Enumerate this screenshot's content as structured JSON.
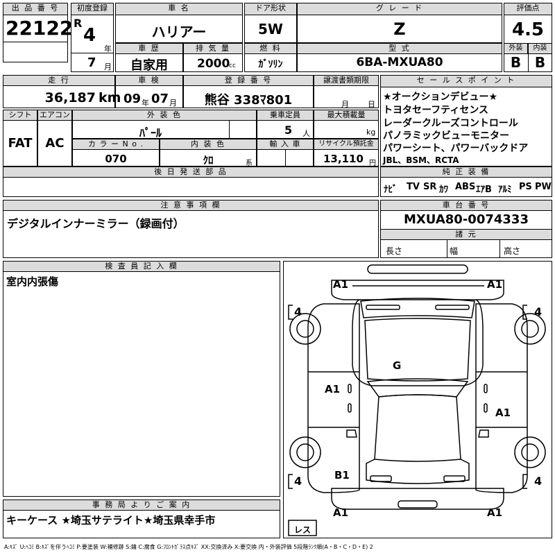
{
  "lot": {
    "label": "出 品 番 号",
    "value": "22122"
  },
  "first_reg": {
    "label": "初度登録",
    "era": "R",
    "year": "4",
    "year_unit": "年",
    "month": "7",
    "month_unit": "月"
  },
  "car_name": {
    "label": "車 名",
    "value": "ハリアー"
  },
  "door": {
    "label": "ドア形状",
    "value": "5W"
  },
  "grade": {
    "label": "グ レ ー ド",
    "value": "Z"
  },
  "score": {
    "label": "評価点",
    "value": "4.5",
    "ext_label": "外装",
    "int_label": "内装",
    "ext": "B",
    "int": "B"
  },
  "history": {
    "label": "車 歴",
    "value": "自家用"
  },
  "displacement": {
    "label": "排 気 量",
    "value": "2000",
    "unit": "cc"
  },
  "fuel": {
    "label": "燃 料",
    "value": "ｶﾞｿﾘﾝ"
  },
  "model": {
    "label": "型 式",
    "value": "6BA-MXUA80"
  },
  "mileage": {
    "label": "走 行",
    "value": "36,187",
    "unit": "km"
  },
  "inspection": {
    "label": "車 検",
    "year": "09",
    "year_unit": "年",
    "month": "07",
    "month_unit": "月"
  },
  "plate": {
    "label": "登 録 番 号",
    "value": "熊谷 338ﾏ801"
  },
  "transfer": {
    "label": "譲渡書類期限",
    "month_unit": "月",
    "day_unit": "日"
  },
  "shift": {
    "label": "シフト",
    "value": "FAT"
  },
  "aircon": {
    "label": "エアコン",
    "value": "AC"
  },
  "exterior_color": {
    "label": "外 装 色",
    "value": "ﾊﾟｰﾙ"
  },
  "capacity": {
    "label": "乗車定員",
    "value": "5",
    "unit": "人"
  },
  "max_load": {
    "label": "最大積載量",
    "unit": "kg"
  },
  "color_no": {
    "label": "カ ラ ー N o .",
    "value": "070"
  },
  "interior_color": {
    "label": "内 装 色",
    "value": "ｸﾛ",
    "suffix": "系"
  },
  "import": {
    "label": "輸 入 車"
  },
  "recycle": {
    "label": "リサイクル預託金",
    "value": "13,110",
    "unit": "円"
  },
  "later_parts": {
    "label": "後 日 発 送 部 品"
  },
  "sales_points": {
    "label": "セ ー ル ス ポ イ ン ト",
    "lines": [
      "★オークションデビュー★",
      "トヨタセーフティセンス",
      "レーダークルーズコントロール",
      "パノラミックビューモニター",
      "パワーシート、パワーバックドア",
      "JBL、BSM、RCTA"
    ]
  },
  "equipment": {
    "label": "純 正 装 備",
    "items": [
      "ﾅﾋﾞ",
      "TV",
      "SR",
      "ｶﾜ",
      "ABS",
      "ｴｱB",
      "ｱﾙﾐ",
      "PS",
      "PW"
    ]
  },
  "notes": {
    "label": "注 意 事 項 欄",
    "value": "デジタルインナーミラー（録画付）"
  },
  "chassis": {
    "label": "車 台 番 号",
    "value": "MXUA80-0074333"
  },
  "specs": {
    "label": "諸 元",
    "length": "長さ",
    "width": "幅",
    "height": "高さ"
  },
  "inspector": {
    "label": "検 査 員 記 入 欄",
    "value": "室内内張傷"
  },
  "office": {
    "label": "事 務 局 よ り ご 案 内",
    "value": "キーケース ★埼玉サテライト★埼玉県幸手市"
  },
  "diagram": {
    "marks": [
      "A1",
      "A1",
      "A1",
      "A1",
      "G",
      "B1",
      "A1",
      "A1"
    ],
    "tires": [
      "4",
      "4",
      "4",
      "4"
    ],
    "spare": "レス"
  },
  "legend": "A:ｷｽﾞ U:ﾍｺﾐ B:ｷｽﾞを伴うﾍｺﾐ P:要塗装 W:補修跡 S:錆 C:腐食 G:ﾌﾛﾝﾄｶﾞﾗｽ点ｷｽﾞ XX:交換済み X:要交換  内・外装評価 5段階ﾗﾝｸ順(A・B・C・D・E) 2"
}
